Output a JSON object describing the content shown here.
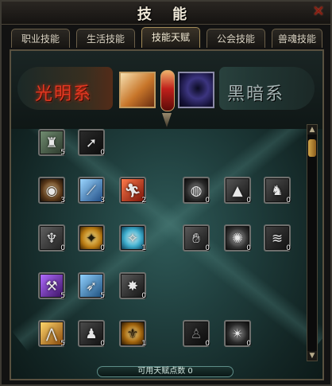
{
  "window": {
    "title": "技 能",
    "close_icon": "close-x-icon",
    "accent_color": "#a48c58"
  },
  "tabs": [
    {
      "label": "职业技能"
    },
    {
      "label": "生活技能"
    },
    {
      "label": "技能天赋",
      "active": true
    },
    {
      "label": "公会技能"
    },
    {
      "label": "兽魂技能"
    }
  ],
  "talent": {
    "light_label": "光明系",
    "dark_label": "黑暗系",
    "points_text": "可用天赋点数 0",
    "light_column": [
      {
        "icon": "armor-helm-icon",
        "level": "5"
      },
      {
        "icon": "strike-slash-icon",
        "level": "0"
      },
      {
        "icon": "eye-icon",
        "level": "3"
      },
      {
        "icon": "wind-slash-icon",
        "level": "3"
      },
      {
        "icon": "fire-runner-icon",
        "level": "2"
      },
      {
        "icon": "pillar-icon",
        "level": "0"
      },
      {
        "icon": "radiant-figure-icon",
        "level": "0"
      },
      {
        "icon": "holy-figure-icon",
        "level": "1"
      },
      {
        "icon": "purple-hammer-icon",
        "level": "5"
      },
      {
        "icon": "archer-bow-icon",
        "level": "5"
      },
      {
        "icon": "shadow-wolf-icon",
        "level": "0"
      },
      {
        "icon": "golden-wings-icon",
        "level": "5"
      },
      {
        "icon": "silhouette-run-icon",
        "level": "0"
      },
      {
        "icon": "golden-crest-icon",
        "level": "1"
      }
    ],
    "dark_column": [
      {
        "icon": "dark-eye-icon",
        "level": "0"
      },
      {
        "icon": "dark-spike-icon",
        "level": "0"
      },
      {
        "icon": "dark-figure-icon",
        "level": "0"
      },
      {
        "icon": "dark-hand-icon",
        "level": "0"
      },
      {
        "icon": "dark-sigil-icon",
        "level": "0"
      },
      {
        "icon": "dark-wave-icon",
        "level": "0"
      },
      {
        "icon": "dark-silhouette-icon",
        "level": "0"
      },
      {
        "icon": "dark-crest-icon",
        "level": "0"
      }
    ]
  }
}
